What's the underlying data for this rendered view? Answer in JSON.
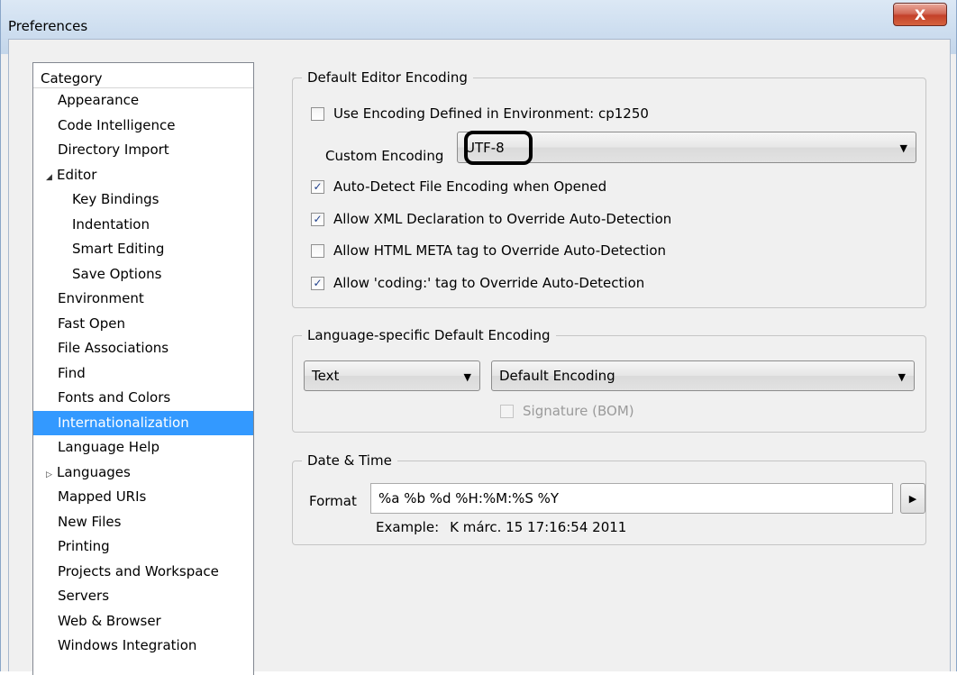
{
  "window": {
    "title": "Preferences",
    "close_label": "X"
  },
  "category": {
    "header": "Category",
    "items": [
      {
        "label": "Appearance",
        "level": 1
      },
      {
        "label": "Code Intelligence",
        "level": 1
      },
      {
        "label": "Directory Import",
        "level": 1
      },
      {
        "label": "Editor",
        "level": 0,
        "expander": "◢"
      },
      {
        "label": "Key Bindings",
        "level": 2
      },
      {
        "label": "Indentation",
        "level": 2
      },
      {
        "label": "Smart Editing",
        "level": 2
      },
      {
        "label": "Save Options",
        "level": 2
      },
      {
        "label": "Environment",
        "level": 1
      },
      {
        "label": "Fast Open",
        "level": 1
      },
      {
        "label": "File Associations",
        "level": 1
      },
      {
        "label": "Find",
        "level": 1
      },
      {
        "label": "Fonts and Colors",
        "level": 1
      },
      {
        "label": "Internationalization",
        "level": 1,
        "selected": true
      },
      {
        "label": "Language Help",
        "level": 1
      },
      {
        "label": "Languages",
        "level": 0,
        "expander": "▷"
      },
      {
        "label": "Mapped URIs",
        "level": 1
      },
      {
        "label": "New Files",
        "level": 1
      },
      {
        "label": "Printing",
        "level": 1
      },
      {
        "label": "Projects and Workspace",
        "level": 1
      },
      {
        "label": "Servers",
        "level": 1
      },
      {
        "label": "Web & Browser",
        "level": 1
      },
      {
        "label": "Windows Integration",
        "level": 1
      }
    ]
  },
  "default_encoding": {
    "legend": "Default Editor Encoding",
    "use_env_label": "Use Encoding Defined in Environment: cp1250",
    "use_env_checked": false,
    "custom_label": "Custom Encoding",
    "custom_value": "UTF-8",
    "options": [
      {
        "label": "Auto-Detect File Encoding when Opened",
        "checked": true,
        "mark": "✓"
      },
      {
        "label": "Allow XML Declaration to Override Auto-Detection",
        "checked": true,
        "mark": "✓"
      },
      {
        "label": "Allow HTML META tag to Override Auto-Detection",
        "checked": false,
        "mark": ""
      },
      {
        "label": "Allow 'coding:' tag to Override Auto-Detection",
        "checked": true,
        "mark": "✓"
      }
    ]
  },
  "language_encoding": {
    "legend": "Language-specific Default Encoding",
    "language_value": "Text",
    "encoding_value": "Default Encoding",
    "signature_label": "Signature (BOM)"
  },
  "datetime": {
    "legend": "Date & Time",
    "format_label": "Format",
    "format_value": "%a %b %d %H:%M:%S %Y",
    "example_label": "Example:",
    "example_value": "K márc. 15 17:16:54 2011"
  },
  "icons": {
    "dropdown_arrow": "▼",
    "play_arrow": "▶"
  }
}
